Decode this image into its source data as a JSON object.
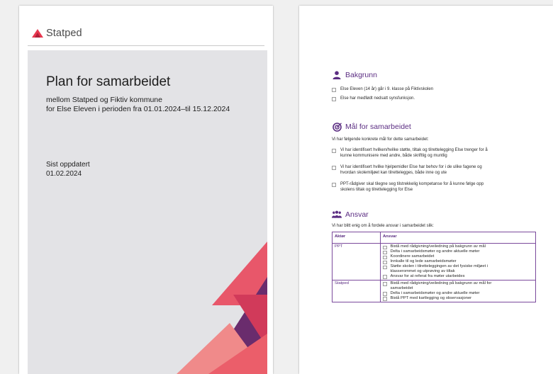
{
  "cover": {
    "logo_text": "Statped",
    "title": "Plan for samarbeidet",
    "subtitle_line1": "mellom Statped og Fiktiv kommune",
    "subtitle_line2": "for Else Eleven i perioden fra 01.01.2024–til 15.12.2024",
    "updated_label": "Sist oppdatert",
    "updated_date": "01.02.2024",
    "colors": {
      "brand_red": "#e8384f",
      "panel": "#e3e3e6",
      "purple": "#5b2d82"
    }
  },
  "background": {
    "heading": "Bakgrunn",
    "icon": "person-icon",
    "items": [
      "Else Eleven (14 år) går i 9. klasse på Fiktivskolen",
      "Else har medfødt nedsatt synsfunksjon."
    ]
  },
  "goals": {
    "heading": "Mål for samarbeidet",
    "icon": "target-icon",
    "intro": "Vi har følgende konkrete mål for dette samarbeidet:",
    "items": [
      {
        "line1": "Vi har identifisert hvilken/hvilke støtte, tiltak og tilrettelegging Else trenger for å",
        "line2": "kunne kommunisere med andre, både skriftlig og muntlig"
      },
      {
        "line1": "Vi har identifisert hvilke hjelpemidler Else har behov for i de ulike fagene og",
        "line2": "hvordan skolemiljøet kan tilrettelegges, både inne og ute"
      },
      {
        "line1": "PPT-rådgiver skal tilegne seg tilstrekkelig kompetanse for å kunne følge opp",
        "line2": "skolens tiltak og tilrettelegging for Else"
      }
    ]
  },
  "responsibility": {
    "heading": "Ansvar",
    "icon": "group-icon",
    "intro": "Vi har blitt enig om å fordele ansvar i samarbeidet slik:",
    "columns": [
      "Aktør",
      "Ansvar"
    ],
    "rows": [
      {
        "actor": "PPT",
        "items": [
          "Bistå med rådgivning/veiledning på bakgrunn av mål",
          "Delta i samarbeidsmøter og andre aktuelle møter",
          "Koordinere samarbeidet",
          "Innkalle til og lede samarbeidsmøter",
          "Støtte skolen i tilretteleggingen av det fysiske miljøet i",
          "Ansvar for at referat fra møter utarbeides"
        ],
        "wrapped": "klasserommet og utprøving av tiltak"
      },
      {
        "actor": "Statped",
        "items": [
          "Bistå med rådgivning/veiledning på bakgrunn av mål for",
          "Delta i samarbeidsmøter og andre aktuelle møter",
          "Bistå PPT med kartlegging og observasjoner"
        ],
        "wrapped": "samarbeidet"
      }
    ]
  }
}
